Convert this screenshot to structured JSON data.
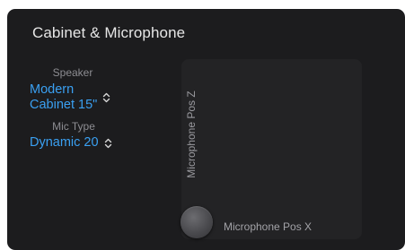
{
  "panel": {
    "title": "Cabinet & Microphone"
  },
  "speaker": {
    "label": "Speaker",
    "value_line1": "Modern",
    "value_line2": "Cabinet 15\""
  },
  "mic_type": {
    "label": "Mic Type",
    "value": "Dynamic 20"
  },
  "xy_pad": {
    "y_axis_label": "Microphone Pos Z",
    "x_axis_label": "Microphone Pos X",
    "x_position": 0.0,
    "z_position": 0.0
  },
  "colors": {
    "panel_background": "#1c1c1e",
    "pad_background": "#232325",
    "accent_blue": "#3aa0f2",
    "label_gray": "#8d8d92"
  },
  "icons": {
    "stepper": "up-down-chevron-icon"
  }
}
